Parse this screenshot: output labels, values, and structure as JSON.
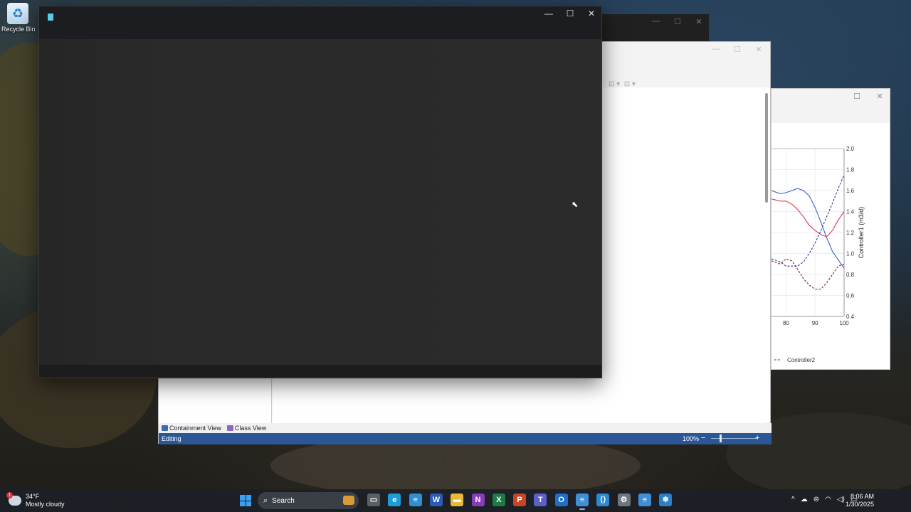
{
  "desktop": {
    "recycle_bin_label": "Recycle Bin"
  },
  "main_window": {
    "caption": {
      "minimize": "—",
      "maximize": "☐",
      "close": "✕"
    }
  },
  "editor_window": {
    "left_tabs": [
      {
        "label": "Containment View"
      },
      {
        "label": "Class View"
      }
    ],
    "status_text": "Editing",
    "zoom_text": "100%",
    "zoom_minus": "−",
    "zoom_plus": "+",
    "zoom_fraction": 0.2
  },
  "chart_window": {
    "caption": {
      "maximize": "☐",
      "close": "✕"
    }
  },
  "chart_data": {
    "type": "line",
    "x": [
      75,
      78,
      80,
      82,
      84,
      86,
      88,
      90,
      92,
      94,
      96,
      98,
      100
    ],
    "xticks": [
      80,
      90,
      100
    ],
    "ylim": [
      0.4,
      2.0
    ],
    "yticks": [
      0.4,
      0.6,
      0.8,
      1.0,
      1.2,
      1.4,
      1.6,
      1.8,
      2.0
    ],
    "ylabel": "Controller1 (m3/d)",
    "series": [
      {
        "name": "",
        "style": "solid",
        "color": "#3b5fd1",
        "values": [
          1.6,
          1.57,
          1.58,
          1.6,
          1.62,
          1.6,
          1.55,
          1.44,
          1.3,
          1.15,
          1.02,
          0.94,
          0.86
        ]
      },
      {
        "name": "",
        "style": "solid",
        "color": "#d63a55",
        "values": [
          1.52,
          1.5,
          1.5,
          1.47,
          1.42,
          1.35,
          1.27,
          1.22,
          1.18,
          1.16,
          1.22,
          1.32,
          1.4
        ]
      },
      {
        "name": "",
        "style": "dashed",
        "color": "#2a3a9a",
        "values": [
          0.95,
          0.92,
          0.88,
          0.88,
          0.88,
          0.92,
          1.0,
          1.1,
          1.22,
          1.35,
          1.48,
          1.62,
          1.75
        ]
      },
      {
        "name": "",
        "style": "dashed",
        "color": "#7a2040",
        "values": [
          0.93,
          0.9,
          0.95,
          0.93,
          0.85,
          0.76,
          0.7,
          0.66,
          0.66,
          0.72,
          0.8,
          0.88,
          0.9
        ]
      }
    ],
    "legend_entries": [
      "Controller2"
    ]
  },
  "cursor_glyph": "⬉",
  "taskbar": {
    "weather": {
      "badge": "1",
      "temp": "34°F",
      "desc": "Mostly cloudy"
    },
    "search_label": "Search",
    "apps": [
      {
        "icon": "task-view-icon",
        "glyph": "▭",
        "color": "#5a5f66"
      },
      {
        "icon": "edge-icon",
        "glyph": "e",
        "color": "#1f9bd7"
      },
      {
        "icon": "stack-app-icon",
        "glyph": "≡",
        "color": "#2f8fd0"
      },
      {
        "icon": "word-icon",
        "glyph": "W",
        "color": "#2b5ab7"
      },
      {
        "icon": "file-explorer-icon",
        "glyph": "▬",
        "color": "#e8b935"
      },
      {
        "icon": "onenote-icon",
        "glyph": "N",
        "color": "#8a3bb8"
      },
      {
        "icon": "excel-icon",
        "glyph": "X",
        "color": "#1e7b45"
      },
      {
        "icon": "powerpoint-icon",
        "glyph": "P",
        "color": "#c84525"
      },
      {
        "icon": "teams-icon",
        "glyph": "T",
        "color": "#5b5fc7"
      },
      {
        "icon": "outlook-icon",
        "glyph": "O",
        "color": "#1e6fc5"
      },
      {
        "icon": "editor-app-icon",
        "glyph": "≡",
        "color": "#3e8fd6"
      },
      {
        "icon": "vscode-icon",
        "glyph": "⟨⟩",
        "color": "#2a8ad4"
      },
      {
        "icon": "settings-icon",
        "glyph": "⚙",
        "color": "#6e7780"
      },
      {
        "icon": "stack-app-2-icon",
        "glyph": "≡",
        "color": "#3e8fd6"
      },
      {
        "icon": "snowflake-app-icon",
        "glyph": "❄",
        "color": "#2a7fc7"
      }
    ],
    "tray": {
      "chevron": "^",
      "cloud": "☁",
      "network": "⊜",
      "wifi": "◠",
      "volume": "◁)",
      "battery": "▭"
    },
    "time": "8:06 AM",
    "date": "1/30/2025"
  }
}
